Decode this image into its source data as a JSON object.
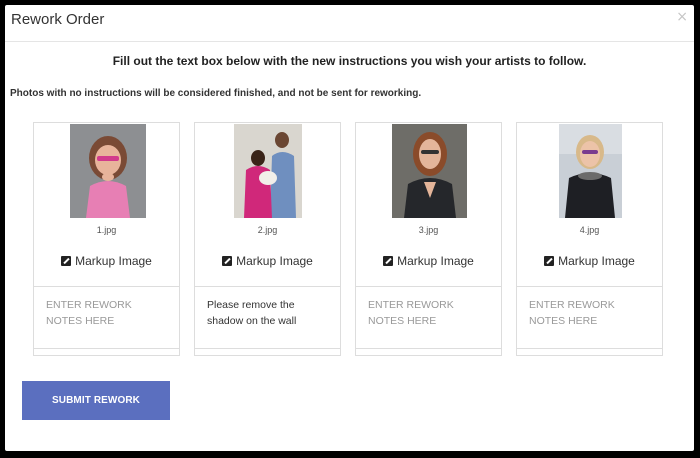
{
  "modal": {
    "title": "Rework Order",
    "close_glyph": "×",
    "instructions": "Fill out the text box below with the new instructions you wish your artists to follow.",
    "subnote": "Photos with no instructions will be considered finished, and not be sent for reworking."
  },
  "photos": [
    {
      "filename": "1.jpg",
      "markup_label": "Markup Image",
      "notes_placeholder": "ENTER REWORK NOTES HERE",
      "notes_value": ""
    },
    {
      "filename": "2.jpg",
      "markup_label": "Markup Image",
      "notes_placeholder": "ENTER REWORK NOTES HERE",
      "notes_value": "Please remove the shadow on the wall"
    },
    {
      "filename": "3.jpg",
      "markup_label": "Markup Image",
      "notes_placeholder": "ENTER REWORK NOTES HERE",
      "notes_value": ""
    },
    {
      "filename": "4.jpg",
      "markup_label": "Markup Image",
      "notes_placeholder": "ENTER REWORK NOTES HERE",
      "notes_value": ""
    }
  ],
  "submit_label": "SUBMIT REWORK",
  "colors": {
    "submit_bg": "#5b6fbf",
    "placeholder": "#999999"
  }
}
